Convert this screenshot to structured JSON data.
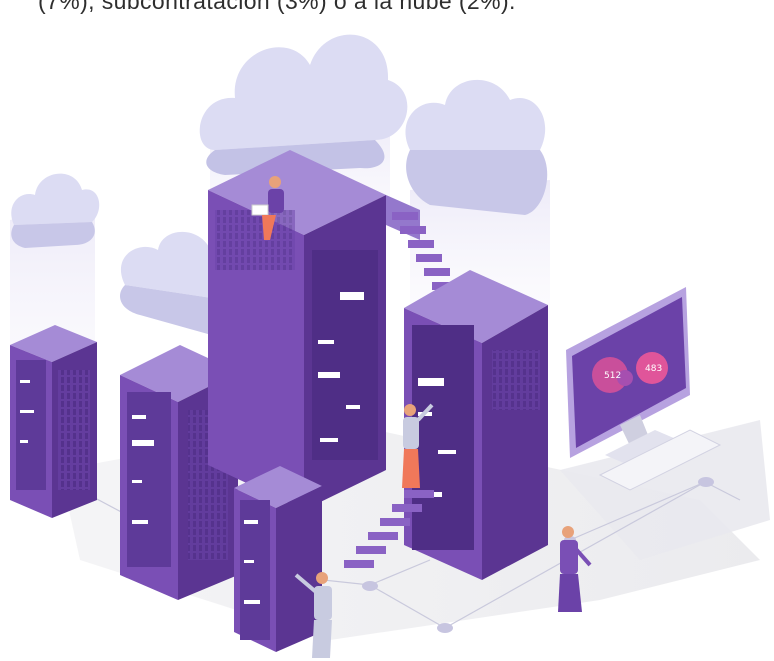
{
  "caption": "(7%), subcontratación (3%) o a la nube (2%).",
  "monitor": {
    "bubble_left_value": "512",
    "bubble_right_value": "483"
  },
  "colors": {
    "rack_front": "#7a4fb5",
    "rack_side": "#5b3592",
    "rack_top": "#a58bd6",
    "cloud": "#dcdcf3",
    "accent": "#e0559a"
  }
}
